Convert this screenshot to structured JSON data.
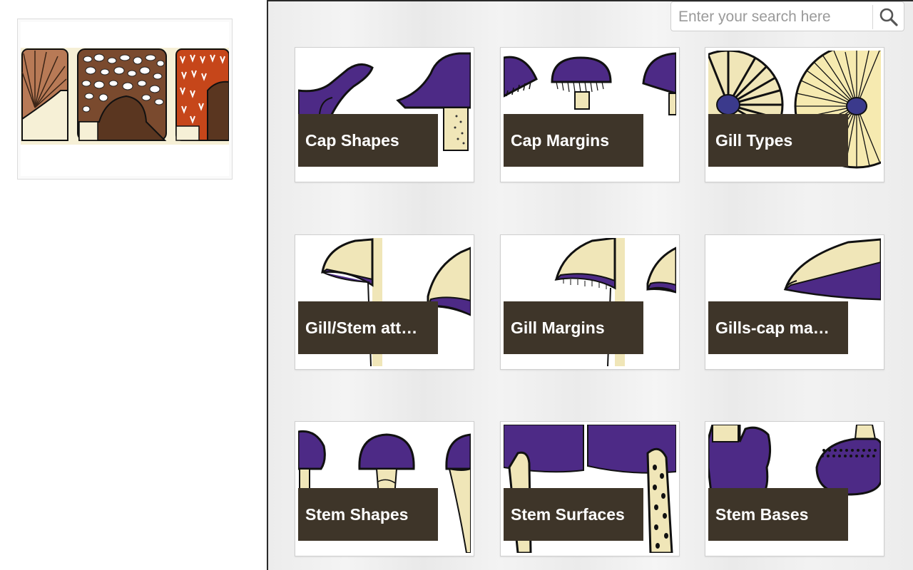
{
  "search": {
    "placeholder": "Enter your search here",
    "value": "",
    "icon": "search-icon"
  },
  "sidebar": {
    "selected_image": "mushroom-cap-texture-illustration"
  },
  "categories": [
    {
      "label": "Cap Shapes"
    },
    {
      "label": "Cap Margins"
    },
    {
      "label": "Gill Types"
    },
    {
      "label": "Gill/Stem att…"
    },
    {
      "label": "Gill Margins"
    },
    {
      "label": "Gills-cap ma…"
    },
    {
      "label": "Stem Shapes"
    },
    {
      "label": "Stem Surfaces"
    },
    {
      "label": "Stem Bases"
    }
  ],
  "colors": {
    "label_bg": "#3e3529",
    "mushroom_purple": "#4d2a86",
    "stem_cream": "#f0e6b8",
    "brown": "#5a3620",
    "rust": "#c6461a"
  }
}
